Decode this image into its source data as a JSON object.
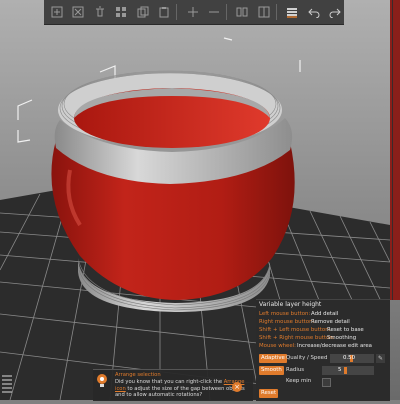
{
  "toolbar": {
    "icons": [
      "add-icon",
      "delete-icon",
      "delete-all-icon",
      "arrange-icon",
      "copy-icon",
      "paste-icon",
      "add-instance-icon",
      "remove-instance-icon",
      "split-objects-icon",
      "split-parts-icon",
      "layers-icon",
      "undo-icon",
      "redo-icon"
    ]
  },
  "layer_panel": {
    "title": "Variable layer height",
    "hints": [
      {
        "key": "Left mouse button:",
        "value": "Add detail"
      },
      {
        "key": "Right mouse button:",
        "value": "Remove detail"
      },
      {
        "key": "Shift + Left mouse button:",
        "value": "Reset to base"
      },
      {
        "key": "Shift + Right mouse button:",
        "value": "Smoothing"
      },
      {
        "key": "Mouse wheel:",
        "value": "Increase/decrease edit area"
      }
    ],
    "adaptive_label": "Adaptive",
    "quality_label": "Quality / Speed",
    "quality_value": "0.50",
    "smooth_label": "Smooth",
    "radius_label": "Radius",
    "radius_value": "5",
    "keep_min_label": "Keep min",
    "reset_label": "Reset"
  },
  "notification": {
    "title": "Arrange selection",
    "body_prefix": "Did you know that you can right-click the",
    "body_link": "Arrange icon",
    "body_suffix": "to adjust the size of the gap between objects and to allow automatic rotations?"
  },
  "colors": {
    "accent": "#e07b2c",
    "model_red": "#b31d14",
    "model_gray": "#c9c9c9",
    "bed_dark": "#2f2f2f"
  }
}
